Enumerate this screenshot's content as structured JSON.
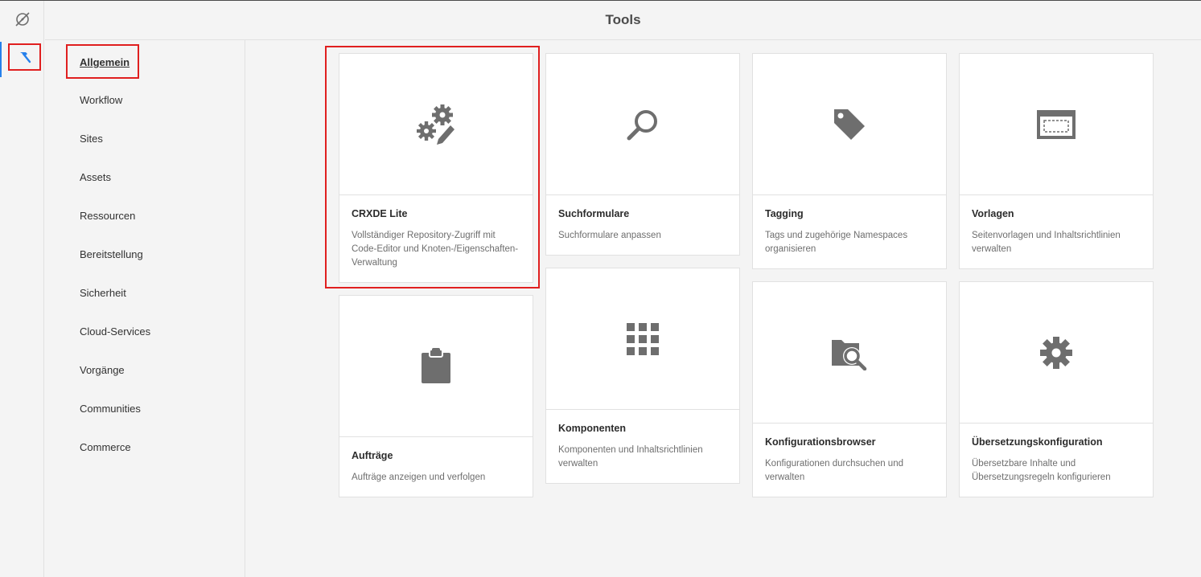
{
  "header": {
    "title": "Tools"
  },
  "rail": {
    "items": [
      {
        "name": "navigation",
        "icon": "compass-off-icon"
      },
      {
        "name": "tools",
        "icon": "hammer-icon",
        "active": true
      }
    ],
    "accent": "#2680eb"
  },
  "nav": {
    "items": [
      {
        "label": "Allgemein",
        "active": true
      },
      {
        "label": "Workflow"
      },
      {
        "label": "Sites"
      },
      {
        "label": "Assets"
      },
      {
        "label": "Ressourcen"
      },
      {
        "label": "Bereitstellung"
      },
      {
        "label": "Sicherheit"
      },
      {
        "label": "Cloud-Services"
      },
      {
        "label": "Vorgänge"
      },
      {
        "label": "Communities"
      },
      {
        "label": "Commerce"
      }
    ]
  },
  "cards": [
    {
      "title": "CRXDE Lite",
      "description": "Vollständiger Repository-Zugriff mit Code-Editor und Knoten-/Eigenschaften-Verwaltung",
      "icon": "gears-pencil-icon"
    },
    {
      "title": "Suchformulare",
      "description": "Suchformulare anpassen",
      "icon": "search-icon"
    },
    {
      "title": "Tagging",
      "description": "Tags und zugehörige Namespaces organisieren",
      "icon": "tag-icon"
    },
    {
      "title": "Vorlagen",
      "description": "Seitenvorlagen und Inhaltsrichtlinien verwalten",
      "icon": "template-icon"
    },
    {
      "title": "Aufträge",
      "description": "Aufträge anzeigen und verfolgen",
      "icon": "clipboard-icon"
    },
    {
      "title": "Komponenten",
      "description": "Komponenten und Inhaltsrichtlinien verwalten",
      "icon": "grid-icon"
    },
    {
      "title": "Konfigurationsbrowser",
      "description": "Konfigurationen durchsuchen und verwalten",
      "icon": "folder-search-icon"
    },
    {
      "title": "Übersetzungskonfiguration",
      "description": "Übersetzbare Inhalte und Übersetzungsregeln konfigurieren",
      "icon": "gear-icon"
    }
  ],
  "colors": {
    "highlight": "#e01f1f",
    "icon": "#6e6e6e",
    "card_bg": "#ffffff",
    "page_bg": "#f4f4f4"
  }
}
